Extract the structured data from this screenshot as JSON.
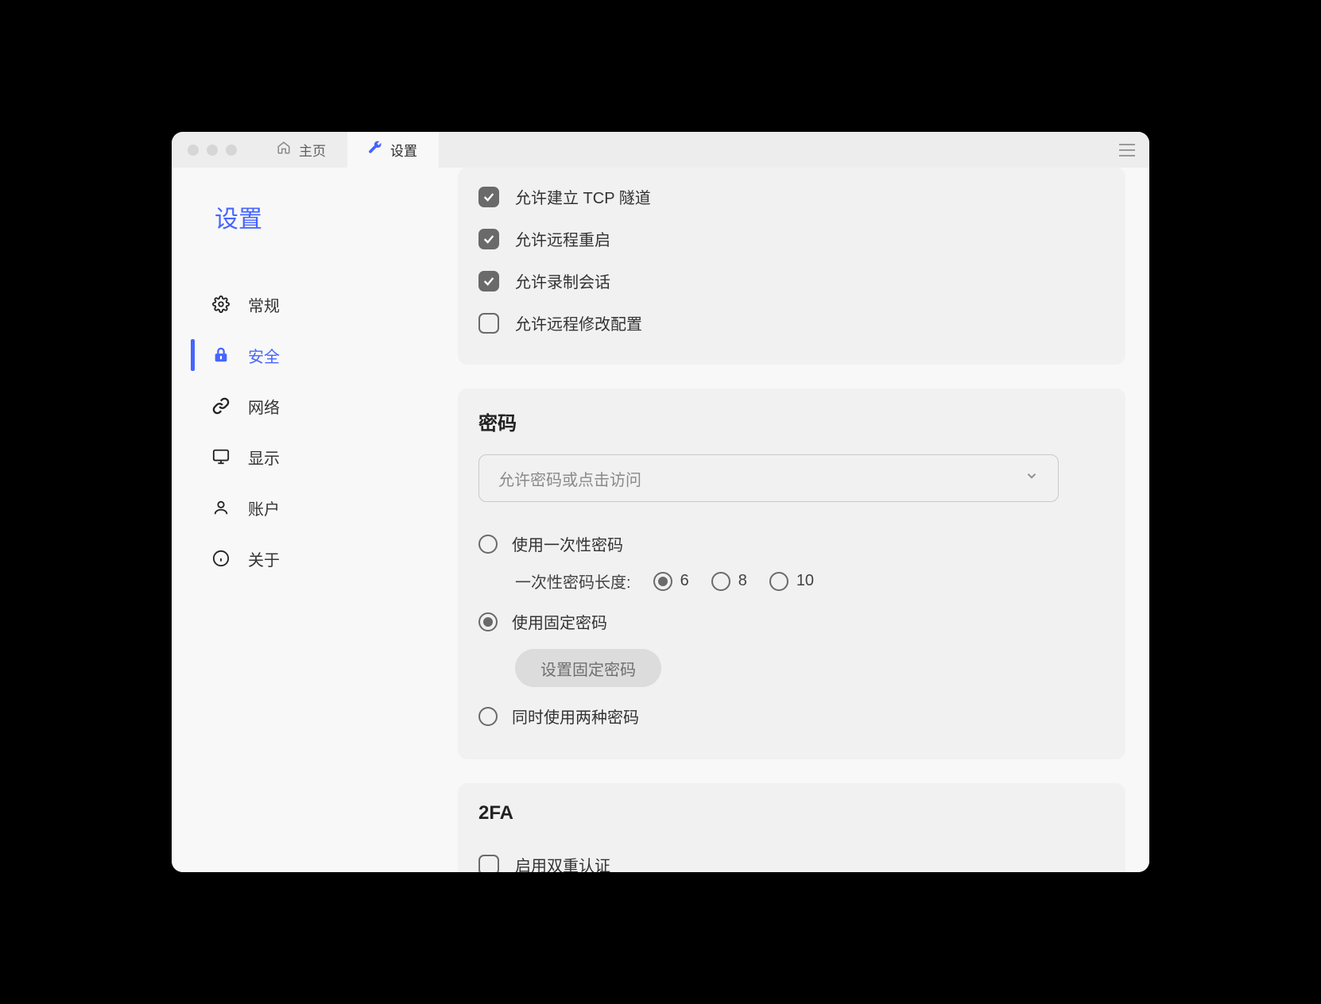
{
  "titlebar": {
    "tab_home": "主页",
    "tab_settings": "设置"
  },
  "sidebar": {
    "title": "设置",
    "items": {
      "general": "常规",
      "security": "安全",
      "network": "网络",
      "display": "显示",
      "account": "账户",
      "about": "关于"
    }
  },
  "permissions": {
    "tcp_tunnel": "允许建立 TCP 隧道",
    "remote_restart": "允许远程重启",
    "record_session": "允许录制会话",
    "remote_config": "允许远程修改配置"
  },
  "password": {
    "title": "密码",
    "select_label": "允许密码或点击访问",
    "one_time": "使用一次性密码",
    "length_label": "一次性密码长度:",
    "len6": "6",
    "len8": "8",
    "len10": "10",
    "fixed": "使用固定密码",
    "set_fixed_btn": "设置固定密码",
    "both": "同时使用两种密码"
  },
  "twofa": {
    "title": "2FA",
    "enable": "启用双重认证"
  }
}
